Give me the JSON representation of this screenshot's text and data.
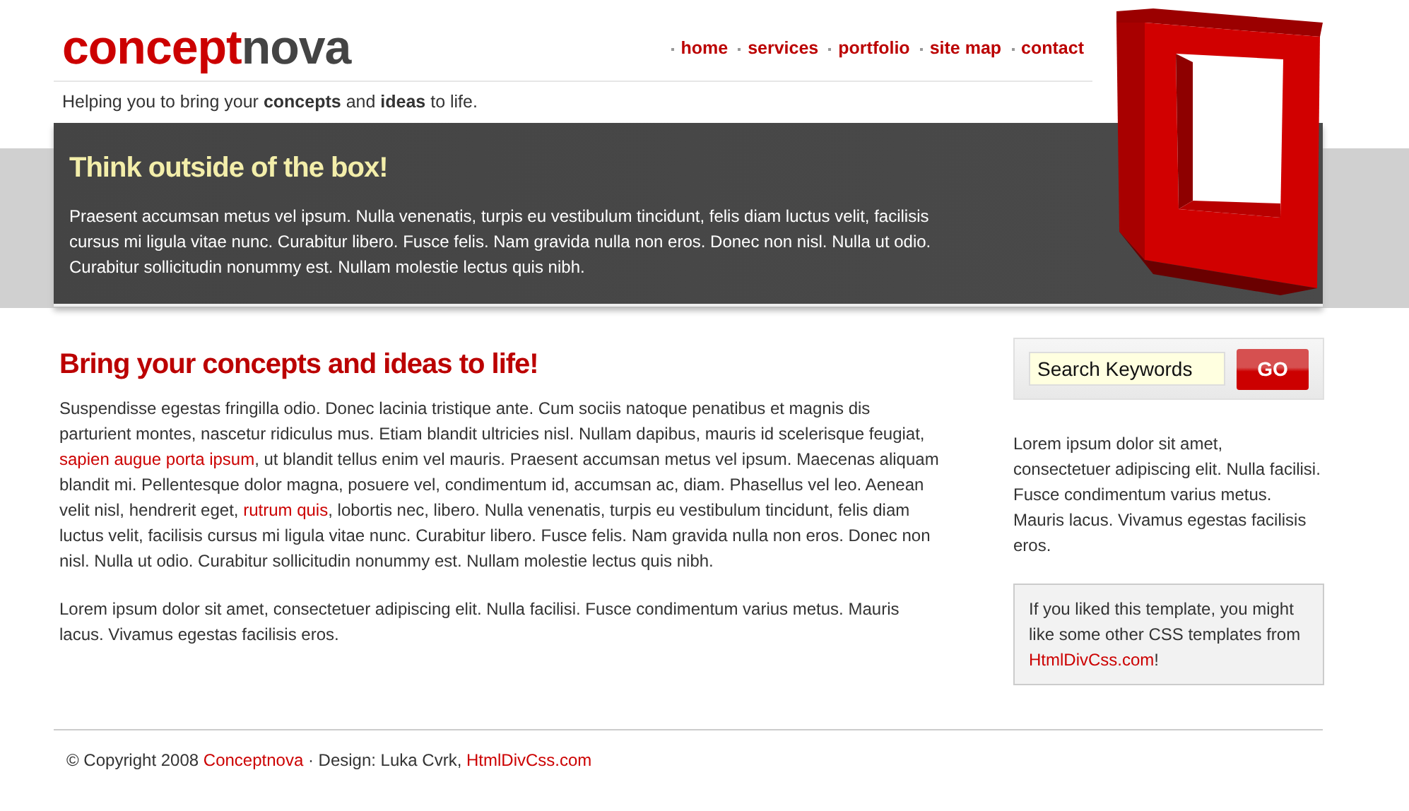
{
  "logo": {
    "part_1": "concept",
    "part_2": "nova"
  },
  "nav": [
    {
      "label": "home"
    },
    {
      "label": "services"
    },
    {
      "label": "portfolio"
    },
    {
      "label": "site map"
    },
    {
      "label": "contact"
    }
  ],
  "tagline": "Helping you to bring your **concepts** and **ideas** to life.",
  "banner": {
    "heading": "Think outside of the box!",
    "text": "Praesent accumsan metus vel ipsum. Nulla venenatis, turpis eu vestibulum tincidunt, felis diam luctus velit, facilisis cursus mi ligula vitae nunc. Curabitur libero. Fusce felis. Nam gravida nulla non eros. Donec non nisl. Nulla ut odio. Curabitur sollicitudin nonummy est. Nullam molestie lectus quis nibh."
  },
  "main": {
    "heading": "Bring your concepts and ideas to life!",
    "paragraphs": [
      [
        {
          "text": "Suspendisse egestas fringilla odio. Donec lacinia tristique ante. Cum sociis natoque penatibus et magnis dis parturient montes, nascetur ridiculus mus. Etiam blandit ultricies nisl. Nullam dapibus, mauris id scelerisque feugiat, ",
          "link": false
        },
        {
          "text": "sapien augue porta ipsum",
          "link": true
        },
        {
          "text": ", ut blandit tellus enim vel mauris. Praesent accumsan metus vel ipsum. Maecenas aliquam blandit mi. Pellentesque dolor magna, posuere vel, condimentum id, accumsan ac, diam. Phasellus vel leo. Aenean velit nisl, hendrerit eget, ",
          "link": false
        },
        {
          "text": "rutrum quis",
          "link": true
        },
        {
          "text": ", lobortis nec, libero. Nulla venenatis, turpis eu vestibulum tincidunt, felis diam luctus velit, facilisis cursus mi ligula vitae nunc. Curabitur libero. Fusce felis. Nam gravida nulla non eros. Donec non nisl. Nulla ut odio. Curabitur sollicitudin nonummy est. Nullam molestie lectus quis nibh.",
          "link": false
        }
      ],
      [
        {
          "text": "Lorem ipsum dolor sit amet, consectetuer adipiscing elit. Nulla facilisi. Fusce condimentum varius metus. Mauris lacus. Vivamus egestas facilisis eros.",
          "link": false
        }
      ]
    ]
  },
  "sidebar": {
    "search": {
      "value": "Search Keywords",
      "button": "GO"
    },
    "text": [
      {
        "text": "Lorem ipsum dolor sit amet, consectetuer adipiscing elit. Nulla facilisi. Fusce condimentum varius metus. Mauris lacus. Vivamus egestas facilisis eros.",
        "link": false
      }
    ],
    "note": [
      {
        "text": "If you liked this template, you might like some other CSS templates from ",
        "link": false
      },
      {
        "text": "HtmlDivCss.com",
        "link": true
      },
      {
        "text": "!",
        "link": false
      }
    ]
  },
  "footer": [
    {
      "text": "© Copyright 2008 ",
      "link": false
    },
    {
      "text": "Conceptnova",
      "link": true
    },
    {
      "text": " · Design: Luka Cvrk, ",
      "link": false
    },
    {
      "text": "HtmlDivCss.com",
      "link": true
    }
  ]
}
